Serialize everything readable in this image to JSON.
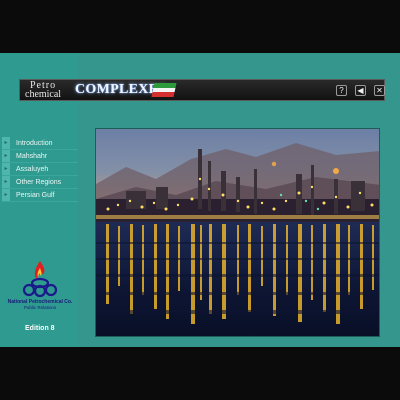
{
  "header": {
    "title_line1": "Petro",
    "title_line2": "chemical",
    "title_main": "COMPLEXES",
    "buttons": [
      {
        "icon": "help-icon",
        "glyph": "?"
      },
      {
        "icon": "speaker-icon",
        "glyph": "◀"
      },
      {
        "icon": "close-icon",
        "glyph": "✕"
      }
    ]
  },
  "nav": {
    "items": [
      {
        "label": "Introduction"
      },
      {
        "label": "Mahshahr"
      },
      {
        "label": "Assaluyeh"
      },
      {
        "label": "Other Regions"
      },
      {
        "label": "Persian Gulf"
      }
    ]
  },
  "logo": {
    "org_name": "National Petrochemical Co.",
    "dept": "Public Relations"
  },
  "edition": "Edition 8",
  "photo": {
    "subject": "petrochemical-complex-night-photo"
  },
  "colors": {
    "accent": "#35968e",
    "flag_green": "#2e9a3e",
    "flag_red": "#d62f2f"
  }
}
